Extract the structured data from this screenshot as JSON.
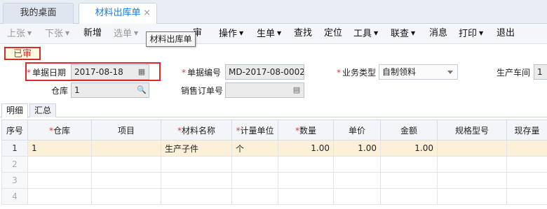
{
  "tabs": {
    "home": "我的桌面",
    "active": "材料出库单",
    "close": "×"
  },
  "toolbar": {
    "prev": "上张",
    "next": "下张",
    "new": "新增",
    "select": "选单",
    "audit": "审",
    "operate": "操作",
    "generate": "生单",
    "find": "查找",
    "locate": "定位",
    "tools": "工具",
    "link": "联查",
    "message": "消息",
    "print": "打印",
    "exit": "退出",
    "tooltip": "材料出库单"
  },
  "status": "已审",
  "form": {
    "date_label": "单据日期",
    "date_value": "2017-08-18",
    "code_label": "单据编号",
    "code_value": "MD-2017-08-0002",
    "biztype_label": "业务类型",
    "biztype_value": "自制领料",
    "workshop_label": "生产车间",
    "workshop_value": "1",
    "warehouse_label": "仓库",
    "warehouse_value": "1",
    "salesorder_label": "销售订单号",
    "salesorder_value": ""
  },
  "subtabs": {
    "detail": "明细",
    "summary": "汇总"
  },
  "grid": {
    "headers": {
      "seq": "序号",
      "warehouse": "仓库",
      "project": "项目",
      "material": "材料名称",
      "unit": "计量单位",
      "qty": "数量",
      "price": "单价",
      "amount": "金额",
      "spec": "规格型号",
      "stock": "现存量"
    },
    "rows": [
      {
        "seq": "1",
        "warehouse": "1",
        "project": "",
        "material": "生产子件",
        "unit": "个",
        "qty": "1.00",
        "price": "1.00",
        "amount": "1.00",
        "spec": "",
        "stock": ""
      },
      {
        "seq": "2"
      },
      {
        "seq": "3"
      },
      {
        "seq": "4"
      }
    ]
  }
}
